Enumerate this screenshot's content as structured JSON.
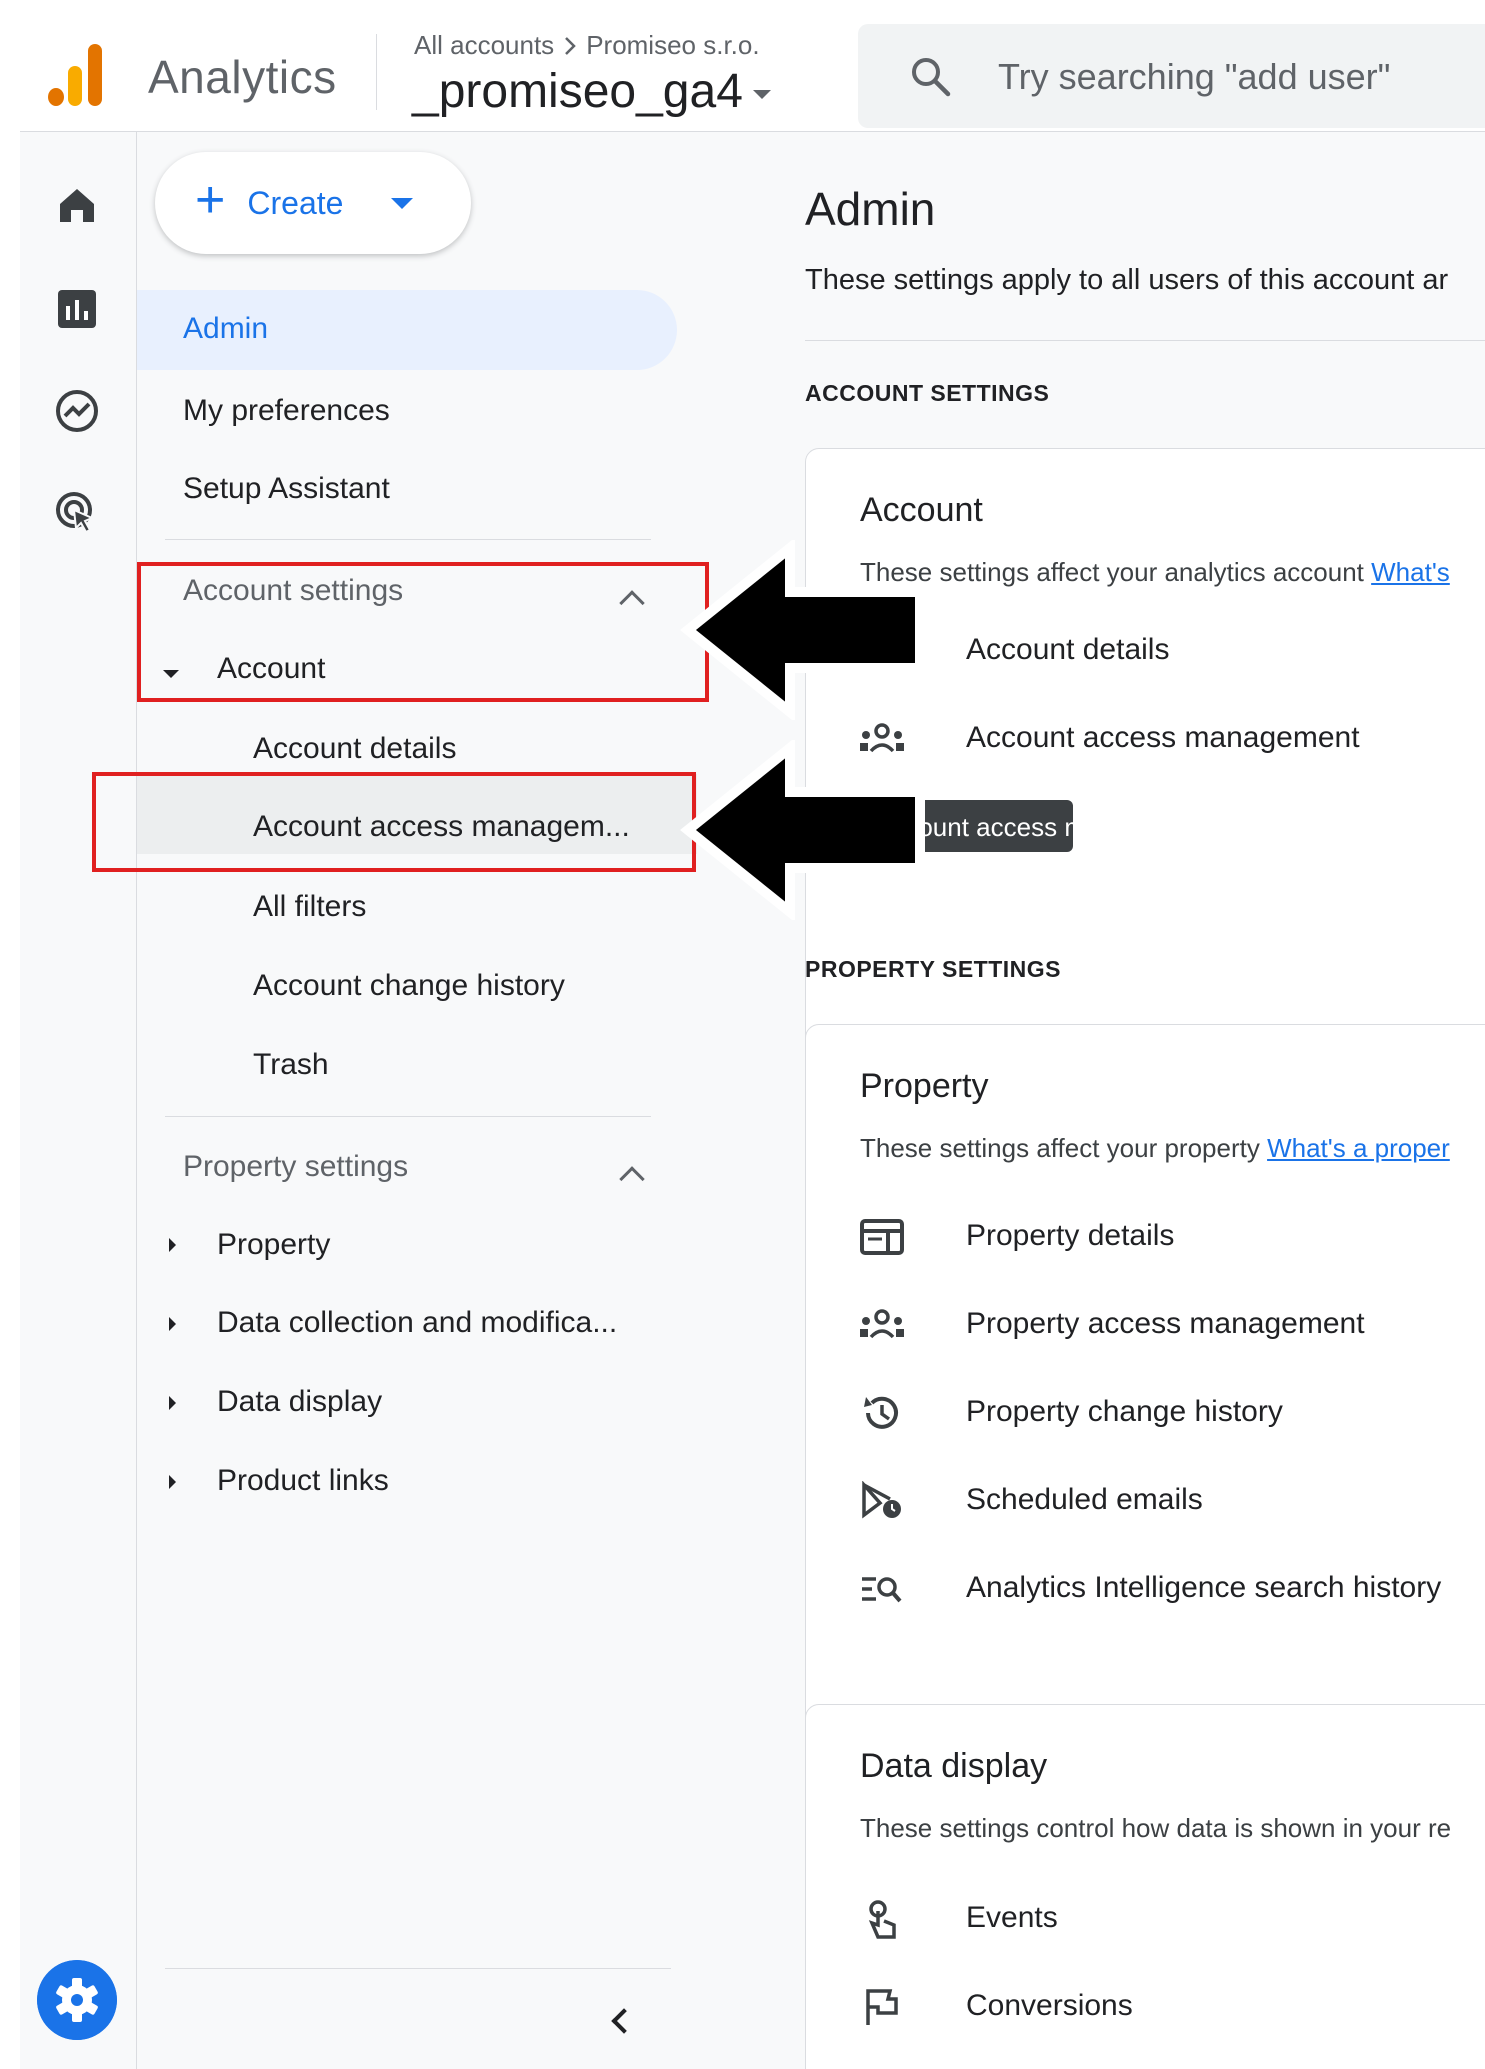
{
  "header": {
    "app_name": "Analytics",
    "breadcrumb": {
      "all_accounts": "All accounts",
      "account": "Promiseo s.r.o."
    },
    "property_name": "_promiseo_ga4",
    "search_placeholder": "Try searching \"add user\""
  },
  "rail": {
    "items": [
      "home-icon",
      "reports-icon",
      "explore-icon",
      "advertising-icon"
    ],
    "settings": "settings-gear-icon"
  },
  "nav": {
    "create_label": "Create",
    "admin_label": "Admin",
    "my_preferences": "My preferences",
    "setup_assistant": "Setup Assistant",
    "account_settings": {
      "heading": "Account settings",
      "account": "Account",
      "items": [
        "Account details",
        "Account access managem...",
        "All filters",
        "Account change history",
        "Trash"
      ]
    },
    "property_settings": {
      "heading": "Property settings",
      "items": [
        "Property",
        "Data collection and modifica...",
        "Data display",
        "Product links"
      ]
    }
  },
  "main": {
    "title": "Admin",
    "description": "These settings apply to all users of this account ar",
    "account_section": "ACCOUNT SETTINGS",
    "account_card": {
      "title": "Account",
      "description": "These settings affect your analytics account",
      "link": "What's",
      "rows": [
        "Account details",
        "Account access management"
      ]
    },
    "tooltip": "Account access management",
    "property_section": "PROPERTY SETTINGS",
    "property_card": {
      "title": "Property",
      "description": "These settings affect your property",
      "link": "What's a proper",
      "rows": [
        "Property details",
        "Property access management",
        "Property change history",
        "Scheduled emails",
        "Analytics Intelligence search history"
      ]
    },
    "data_display_card": {
      "title": "Data display",
      "description": "These settings control how data is shown in your re",
      "rows": [
        "Events",
        "Conversions"
      ]
    }
  },
  "colors": {
    "accent": "#1a73e8",
    "highlight": "#e02020",
    "arrow": "#000000"
  }
}
